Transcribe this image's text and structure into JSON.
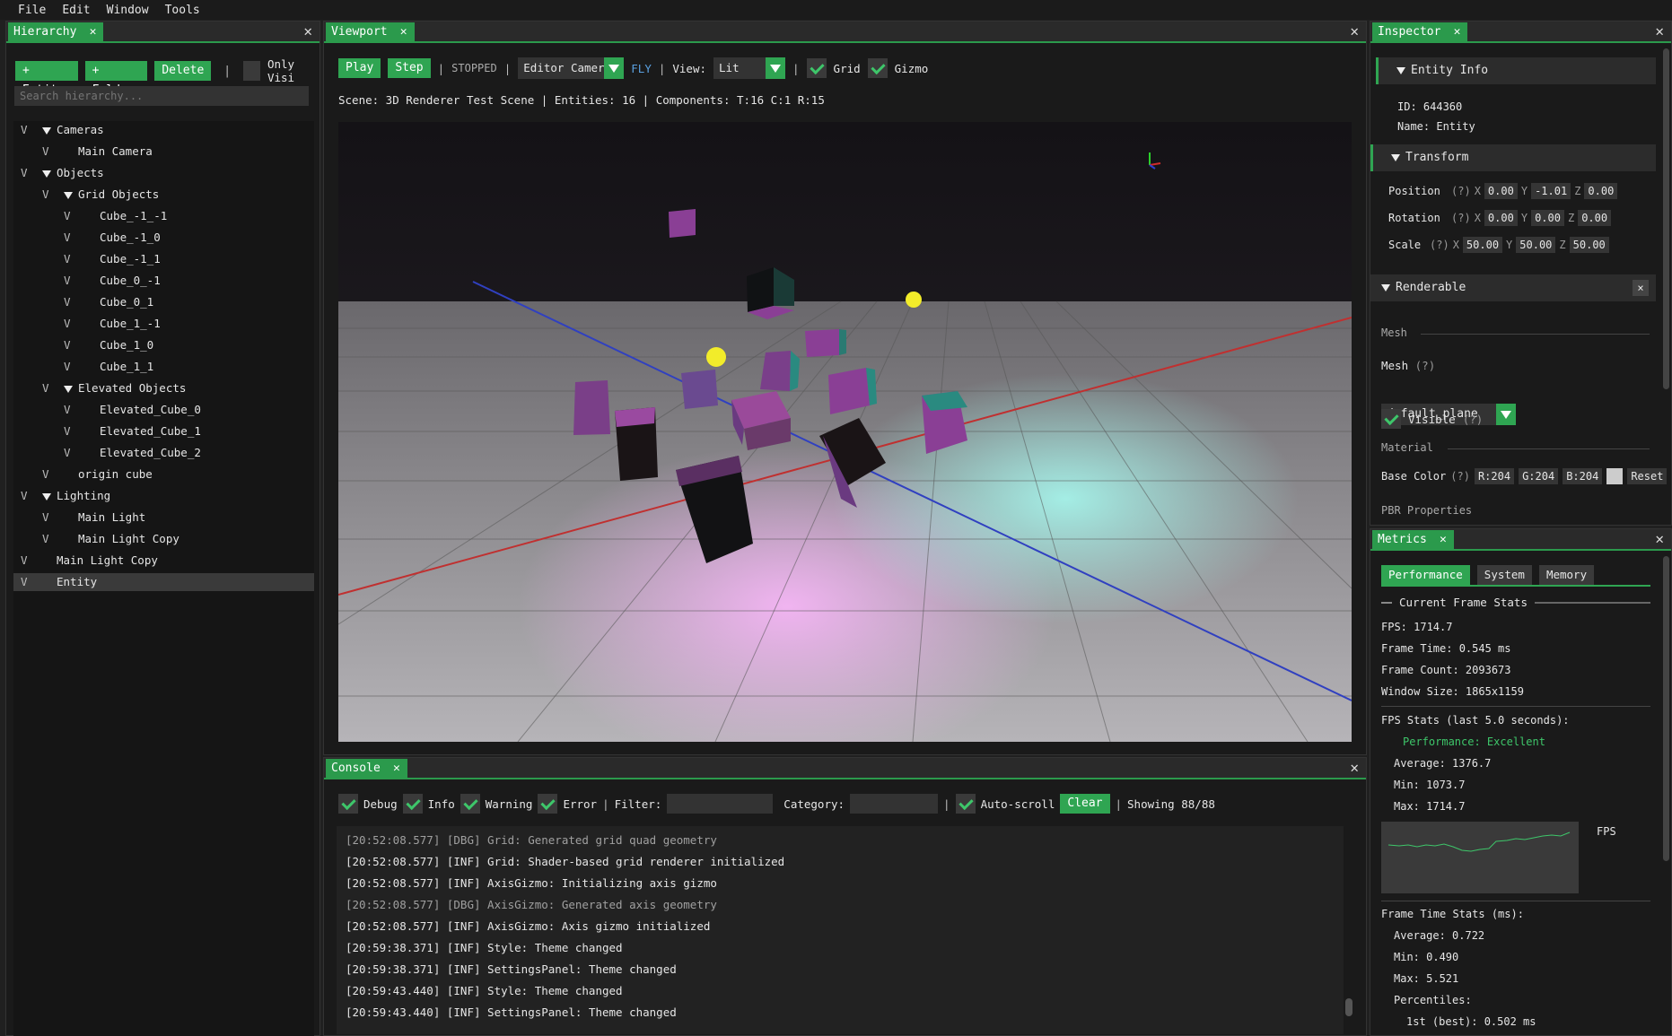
{
  "menu": [
    "File",
    "Edit",
    "Window",
    "Tools"
  ],
  "hierarchy": {
    "tab": "Hierarchy",
    "buttons": {
      "entity": "+ Entity",
      "folder": "+ Folder",
      "delete": "Delete"
    },
    "only_visible": "Only Visi",
    "search_placeholder": "Search hierarchy...",
    "items": [
      {
        "label": "Cameras",
        "depth": 0,
        "expanded": true
      },
      {
        "label": "Main Camera",
        "depth": 1,
        "expanded": false
      },
      {
        "label": "Objects",
        "depth": 0,
        "expanded": true
      },
      {
        "label": "Grid Objects",
        "depth": 1,
        "expanded": true
      },
      {
        "label": "Cube_-1_-1",
        "depth": 2,
        "expanded": false
      },
      {
        "label": "Cube_-1_0",
        "depth": 2,
        "expanded": false
      },
      {
        "label": "Cube_-1_1",
        "depth": 2,
        "expanded": false
      },
      {
        "label": "Cube_0_-1",
        "depth": 2,
        "expanded": false
      },
      {
        "label": "Cube_0_1",
        "depth": 2,
        "expanded": false
      },
      {
        "label": "Cube_1_-1",
        "depth": 2,
        "expanded": false
      },
      {
        "label": "Cube_1_0",
        "depth": 2,
        "expanded": false
      },
      {
        "label": "Cube_1_1",
        "depth": 2,
        "expanded": false
      },
      {
        "label": "Elevated Objects",
        "depth": 1,
        "expanded": true
      },
      {
        "label": "Elevated_Cube_0",
        "depth": 2,
        "expanded": false
      },
      {
        "label": "Elevated_Cube_1",
        "depth": 2,
        "expanded": false
      },
      {
        "label": "Elevated_Cube_2",
        "depth": 2,
        "expanded": false
      },
      {
        "label": "origin cube",
        "depth": 1,
        "expanded": false
      },
      {
        "label": "Lighting",
        "depth": 0,
        "expanded": true
      },
      {
        "label": "Main Light",
        "depth": 1,
        "expanded": false
      },
      {
        "label": "Main Light Copy",
        "depth": 1,
        "expanded": false
      },
      {
        "label": "Main Light Copy",
        "depth": 0,
        "expanded": false
      },
      {
        "label": "Entity",
        "depth": 0,
        "expanded": false,
        "selected": true
      }
    ],
    "vis_marker": "V"
  },
  "viewport": {
    "tab": "Viewport",
    "play": "Play",
    "step": "Step",
    "state": "STOPPED",
    "camera": "Editor Camera",
    "mode": "FLY",
    "view_label": "View:",
    "view": "Lit",
    "grid": "Grid",
    "gizmo": "Gizmo",
    "sep": "|",
    "scene_info": "Scene: 3D Renderer Test Scene | Entities: 16 | Components: T:16 C:1 R:15"
  },
  "console": {
    "tab": "Console",
    "filters": [
      "Debug",
      "Info",
      "Warning",
      "Error"
    ],
    "filter_label": "Filter:",
    "category_label": "Category:",
    "autoscroll": "Auto-scroll",
    "clear": "Clear",
    "showing": "Showing 88/88",
    "lines": [
      {
        "text": "[20:52:08.577] [DBG] Grid: Generated grid quad geometry",
        "level": "dbg"
      },
      {
        "text": "[20:52:08.577] [INF] Grid: Shader-based grid renderer initialized",
        "level": "inf"
      },
      {
        "text": "[20:52:08.577] [INF] AxisGizmo: Initializing axis gizmo",
        "level": "inf"
      },
      {
        "text": "[20:52:08.577] [DBG] AxisGizmo: Generated axis geometry",
        "level": "dbg"
      },
      {
        "text": "[20:52:08.577] [INF] AxisGizmo: Axis gizmo initialized",
        "level": "inf"
      },
      {
        "text": "[20:59:38.371] [INF] Style: Theme changed",
        "level": "inf"
      },
      {
        "text": "[20:59:38.371] [INF] SettingsPanel: Theme changed",
        "level": "inf"
      },
      {
        "text": "[20:59:43.440] [INF] Style: Theme changed",
        "level": "inf"
      },
      {
        "text": "[20:59:43.440] [INF] SettingsPanel: Theme changed",
        "level": "inf"
      }
    ]
  },
  "inspector": {
    "tab": "Inspector",
    "entity_info": "Entity Info",
    "id": "ID: 644360",
    "name": "Name: Entity",
    "transform": "Transform",
    "position": {
      "label": "Position",
      "help": "(?)",
      "x": "0.00",
      "y": "-1.01",
      "z": "0.00"
    },
    "rotation": {
      "label": "Rotation",
      "help": "(?)",
      "x": "0.00",
      "y": "0.00",
      "z": "0.00"
    },
    "scale": {
      "label": "Scale",
      "help": "(?)",
      "x": "50.00",
      "y": "50.00",
      "z": "50.00"
    },
    "renderable": "Renderable",
    "remove": "×",
    "mesh_header": "Mesh",
    "mesh_label": "Mesh",
    "mesh_help": "(?)",
    "mesh_value": "default_plane",
    "visible": "Visible",
    "visible_help": "(?)",
    "material_header": "Material",
    "base_color": "Base Color",
    "base_color_help": "(?)",
    "r": "R:204",
    "g": "G:204",
    "b": "B:204",
    "reset": "Reset",
    "pbr": "PBR Properties",
    "axis": {
      "x": "X",
      "y": "Y",
      "z": "Z"
    }
  },
  "metrics": {
    "tab": "Metrics",
    "tabs": [
      "Performance",
      "System",
      "Memory"
    ],
    "current": "Current Frame Stats",
    "fps": "FPS: 1714.7",
    "frame_time": "Frame Time: 0.545 ms",
    "frame_count": "Frame Count: 2093673",
    "window_size": "Window Size: 1865x1159",
    "fps_stats": "FPS Stats (last 5.0 seconds):",
    "performance": "Performance: Excellent",
    "avg": "Average: 1376.7",
    "min": "Min: 1073.7",
    "max": "Max: 1714.7",
    "graph_label": "FPS",
    "ft_stats": "Frame Time Stats (ms):",
    "ft_avg": "Average: 0.722",
    "ft_min": "Min: 0.490",
    "ft_max": "Max: 5.521",
    "percentiles": "Percentiles:",
    "p1": "1st (best): 0.502 ms"
  },
  "colors": {
    "accent": "#2fa552",
    "perf_text": "#3ec66a"
  }
}
